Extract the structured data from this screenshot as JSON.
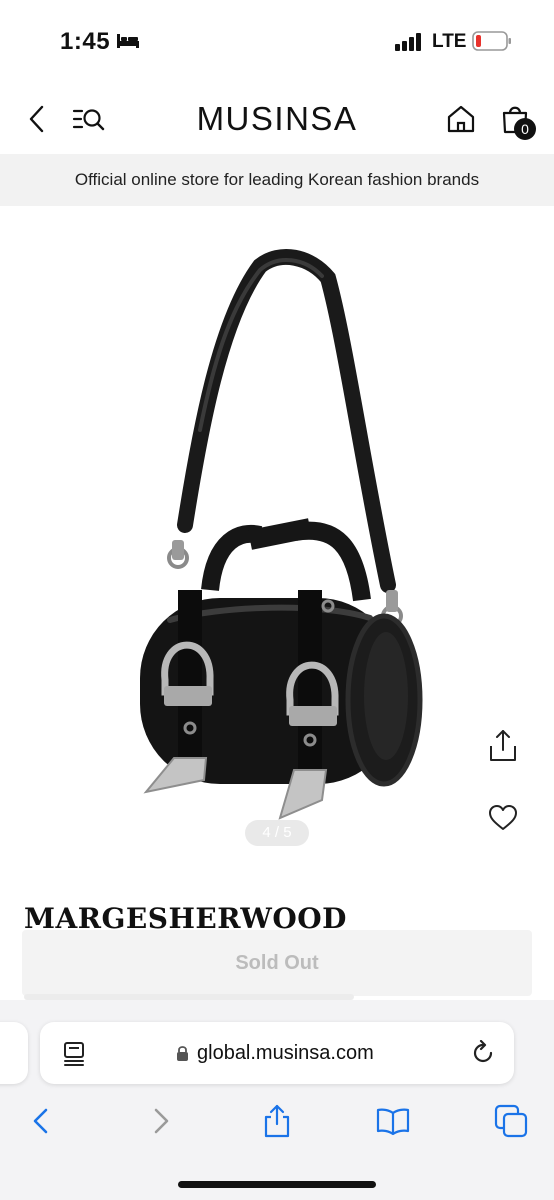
{
  "status_bar": {
    "time": "1:45",
    "network": "LTE",
    "icons": [
      "bed-icon",
      "signal-icon",
      "battery-low-icon"
    ]
  },
  "header": {
    "logo": "MUSINSA",
    "cart_count": "0",
    "icons": [
      "chevron-left-icon",
      "menu-search-icon",
      "home-icon",
      "shopping-bag-icon"
    ]
  },
  "banner": {
    "text": "Official online store for leading Korean fashion brands"
  },
  "product": {
    "image_icon": "black-leather-buckle-bag-image",
    "page_indicator": "4 / 5",
    "brand": "MARGESHERWOOD",
    "action_label": "Sold Out",
    "icons": [
      "share-icon",
      "heart-icon"
    ]
  },
  "browser": {
    "url": "global.musinsa.com",
    "icons": [
      "reader-icon",
      "lock-icon",
      "reload-icon",
      "back-arrow-icon",
      "forward-arrow-icon",
      "share-icon",
      "bookmarks-icon",
      "tabs-icon"
    ]
  },
  "colors": {
    "text": "#111111",
    "banner_bg": "#f2f2f2",
    "safari_blue": "#1a73e8",
    "disabled_text": "#bcbcbc"
  }
}
